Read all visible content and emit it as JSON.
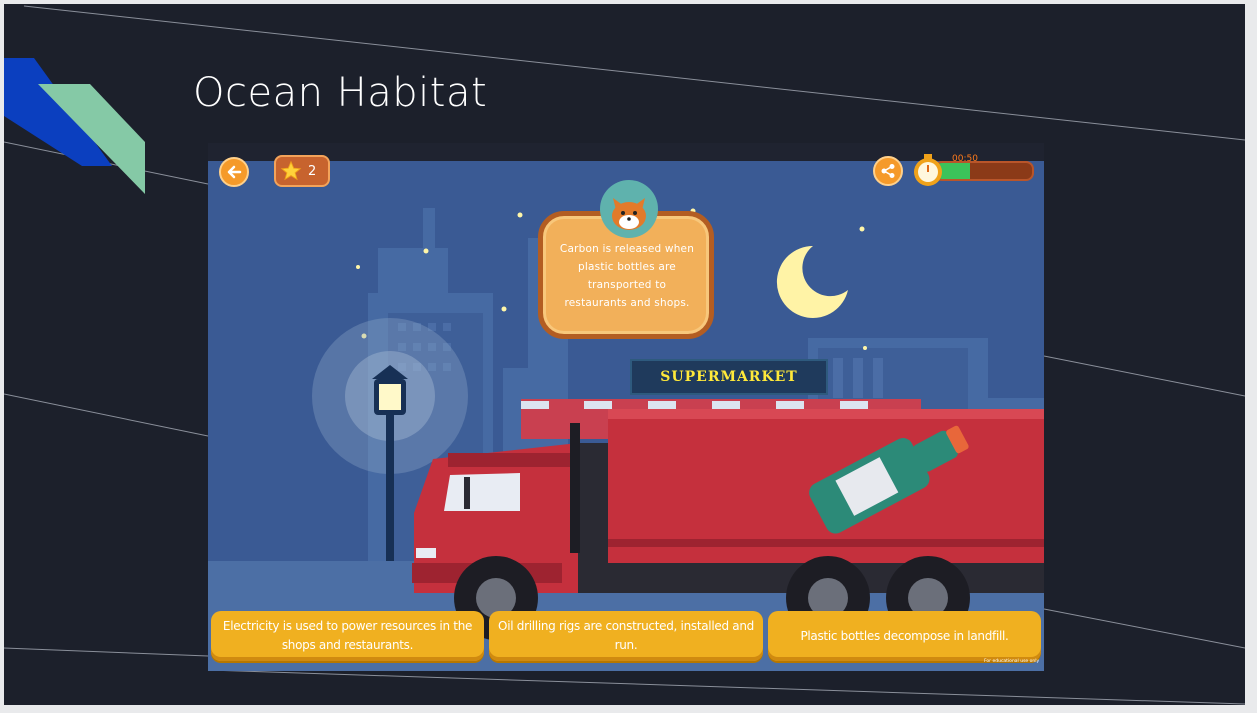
{
  "slide": {
    "title": "Ocean Habitat",
    "accent_colors": {
      "blue": "#0b3fbf",
      "green": "#85c9a6",
      "background": "#1c202b"
    }
  },
  "game": {
    "back_icon": "arrow-left-icon",
    "star_icon": "star-icon",
    "star_count": "2",
    "share_icon": "share-icon",
    "timer": {
      "icon": "stopwatch-icon",
      "label": "00:50",
      "remaining_fraction": 0.35
    },
    "fact_bubble": {
      "avatar_icon": "cat-face-icon",
      "text": "Carbon is released when plastic bottles are transported to restaurants and shops."
    },
    "scene": {
      "supermarket_sign": "SUPERMARKET"
    },
    "options": [
      "Electricity is used to power resources in the shops and restaurants.",
      "Oil drilling rigs are constructed, installed and run.",
      "Plastic bottles decompose in landfill."
    ],
    "footer_note": "For educational use only"
  }
}
